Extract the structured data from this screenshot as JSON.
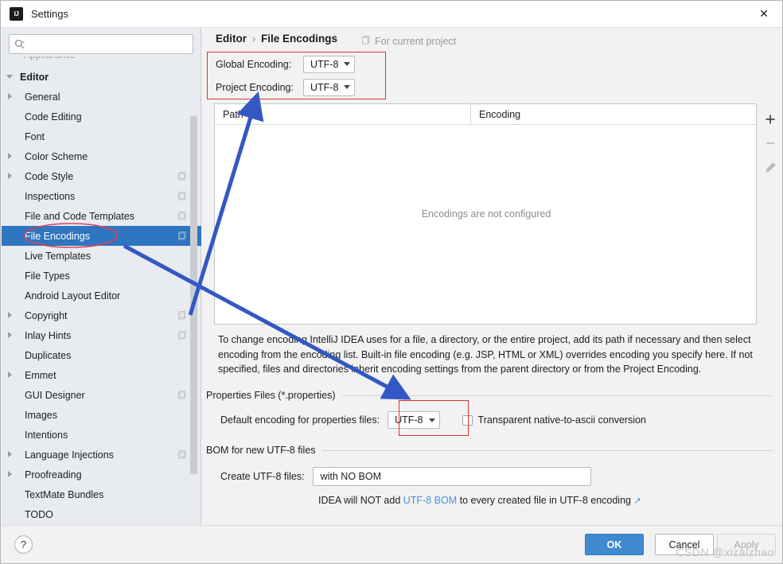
{
  "window": {
    "title": "Settings",
    "logo_icon": "intellij-idea-logo",
    "close_icon": "close-icon"
  },
  "sidebar": {
    "search": {
      "placeholder": "",
      "value": "",
      "icon": "search-icon"
    },
    "items": [
      {
        "label": "Editor",
        "depth": 0,
        "arrow": "expanded",
        "project_icon": false,
        "selected": false
      },
      {
        "label": "General",
        "depth": 1,
        "arrow": "collapsed",
        "project_icon": false,
        "selected": false
      },
      {
        "label": "Code Editing",
        "depth": 1,
        "arrow": "none",
        "project_icon": false,
        "selected": false
      },
      {
        "label": "Font",
        "depth": 1,
        "arrow": "none",
        "project_icon": false,
        "selected": false
      },
      {
        "label": "Color Scheme",
        "depth": 1,
        "arrow": "collapsed",
        "project_icon": false,
        "selected": false
      },
      {
        "label": "Code Style",
        "depth": 1,
        "arrow": "collapsed",
        "project_icon": true,
        "selected": false
      },
      {
        "label": "Inspections",
        "depth": 1,
        "arrow": "none",
        "project_icon": true,
        "selected": false
      },
      {
        "label": "File and Code Templates",
        "depth": 1,
        "arrow": "none",
        "project_icon": true,
        "selected": false
      },
      {
        "label": "File Encodings",
        "depth": 1,
        "arrow": "none",
        "project_icon": true,
        "selected": true
      },
      {
        "label": "Live Templates",
        "depth": 1,
        "arrow": "none",
        "project_icon": false,
        "selected": false
      },
      {
        "label": "File Types",
        "depth": 1,
        "arrow": "none",
        "project_icon": false,
        "selected": false
      },
      {
        "label": "Android Layout Editor",
        "depth": 1,
        "arrow": "none",
        "project_icon": false,
        "selected": false
      },
      {
        "label": "Copyright",
        "depth": 1,
        "arrow": "collapsed",
        "project_icon": true,
        "selected": false
      },
      {
        "label": "Inlay Hints",
        "depth": 1,
        "arrow": "collapsed",
        "project_icon": true,
        "selected": false
      },
      {
        "label": "Duplicates",
        "depth": 1,
        "arrow": "none",
        "project_icon": false,
        "selected": false
      },
      {
        "label": "Emmet",
        "depth": 1,
        "arrow": "collapsed",
        "project_icon": false,
        "selected": false
      },
      {
        "label": "GUI Designer",
        "depth": 1,
        "arrow": "none",
        "project_icon": true,
        "selected": false
      },
      {
        "label": "Images",
        "depth": 1,
        "arrow": "none",
        "project_icon": false,
        "selected": false
      },
      {
        "label": "Intentions",
        "depth": 1,
        "arrow": "none",
        "project_icon": false,
        "selected": false
      },
      {
        "label": "Language Injections",
        "depth": 1,
        "arrow": "collapsed",
        "project_icon": true,
        "selected": false
      },
      {
        "label": "Proofreading",
        "depth": 1,
        "arrow": "collapsed",
        "project_icon": false,
        "selected": false
      },
      {
        "label": "TextMate Bundles",
        "depth": 1,
        "arrow": "none",
        "project_icon": false,
        "selected": false
      },
      {
        "label": "TODO",
        "depth": 1,
        "arrow": "none",
        "project_icon": false,
        "selected": false
      }
    ]
  },
  "main": {
    "breadcrumb": {
      "root": "Editor",
      "separator": "›",
      "current": "File Encodings"
    },
    "for_current_project": {
      "label": "For current project",
      "icon": "project-scope-icon"
    },
    "global_encoding": {
      "label": "Global Encoding:",
      "value": "UTF-8"
    },
    "project_encoding": {
      "label": "Project Encoding:",
      "value": "UTF-8"
    },
    "table": {
      "columns": [
        "Path",
        "Encoding"
      ],
      "sort_column": "Path",
      "sort_direction": "ascending",
      "rows": [],
      "empty_message": "Encodings are not configured",
      "toolbar": [
        {
          "name": "add-button",
          "glyph": "+",
          "enabled": true
        },
        {
          "name": "remove-button",
          "glyph": "−",
          "enabled": false
        },
        {
          "name": "edit-button",
          "glyph": "pencil",
          "enabled": false
        }
      ]
    },
    "description": "To change encoding IntelliJ IDEA uses for a file, a directory, or the entire project, add its path if necessary and then select encoding from the encoding list. Built-in file encoding (e.g. JSP, HTML or XML) overrides encoding you specify here. If not specified, files and directories inherit encoding settings from the parent directory or from the Project Encoding.",
    "properties_group": {
      "title": "Properties Files (*.properties)",
      "default_encoding_label": "Default encoding for properties files:",
      "default_encoding_value": "UTF-8",
      "transparent_checkbox_label": "Transparent native-to-ascii conversion",
      "transparent_checked": false
    },
    "bom_group": {
      "title": "BOM for new UTF-8 files",
      "create_label": "Create UTF-8 files:",
      "create_value": "with NO BOM",
      "note_prefix": "IDEA will NOT add ",
      "note_link": "UTF-8 BOM",
      "note_suffix": " to every created file in UTF-8 encoding",
      "note_external_icon": "↗"
    }
  },
  "footer": {
    "help_label": "?",
    "ok_label": "OK",
    "cancel_label": "Cancel",
    "apply_label": "Apply",
    "apply_enabled": false
  },
  "watermark": {
    "text": "CSDN @xizaizhao"
  },
  "annotations": {
    "ellipse_target": "File Encodings",
    "ellipse_color": "#d94452",
    "box_color": "#e03030",
    "arrow_color": "#3358c4",
    "arrow_up_label": "points from File Encodings to encoding dropdowns",
    "arrow_down_label": "points from File Encodings to default properties encoding dropdown"
  }
}
